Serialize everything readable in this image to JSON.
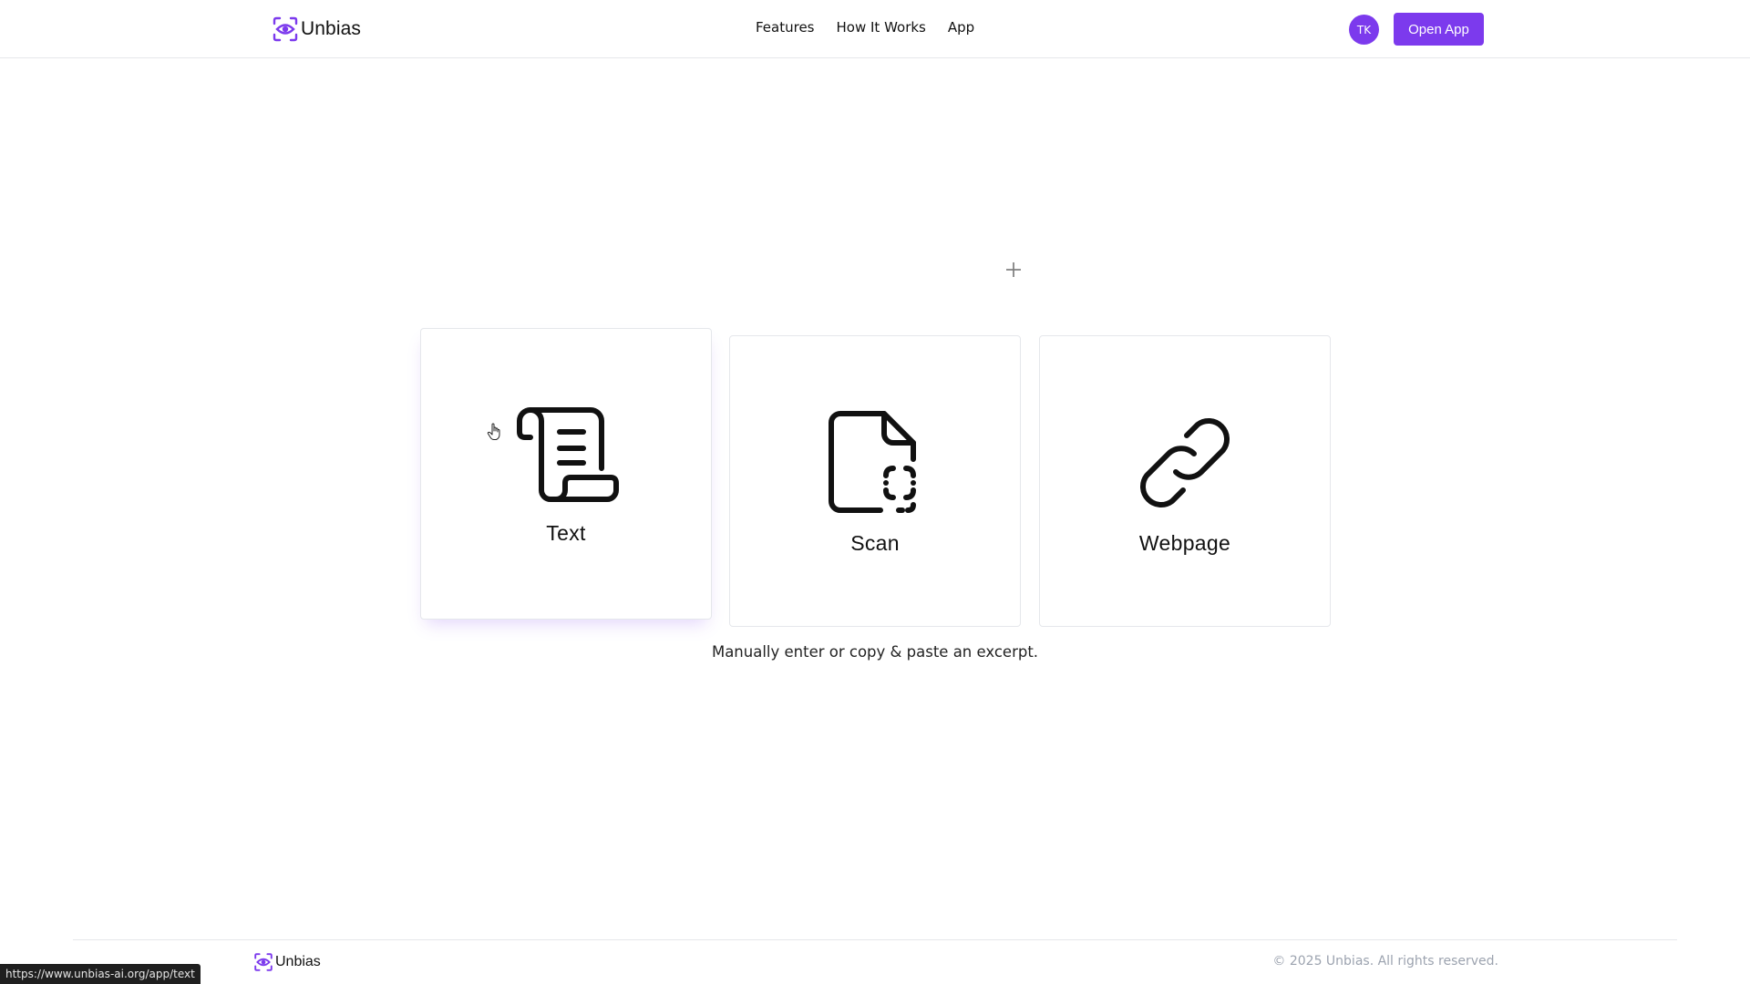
{
  "brand": {
    "name": "Unbias",
    "accent_color": "#7c3aed"
  },
  "nav": {
    "items": [
      {
        "label": "Features"
      },
      {
        "label": "How It Works"
      },
      {
        "label": "App"
      }
    ]
  },
  "user": {
    "initials": "TK"
  },
  "header": {
    "open_app_label": "Open App"
  },
  "cards": [
    {
      "label": "Text",
      "icon": "scroll-icon",
      "selected": true
    },
    {
      "label": "Scan",
      "icon": "file-scan-icon",
      "selected": false
    },
    {
      "label": "Webpage",
      "icon": "link-icon",
      "selected": false
    }
  ],
  "description": "Manually enter or copy & paste an excerpt.",
  "footer": {
    "brand": "Unbias",
    "copyright": "© 2025 Unbias. All rights reserved."
  },
  "status_bar": {
    "url": "https://www.unbias-ai.org/app/text"
  }
}
